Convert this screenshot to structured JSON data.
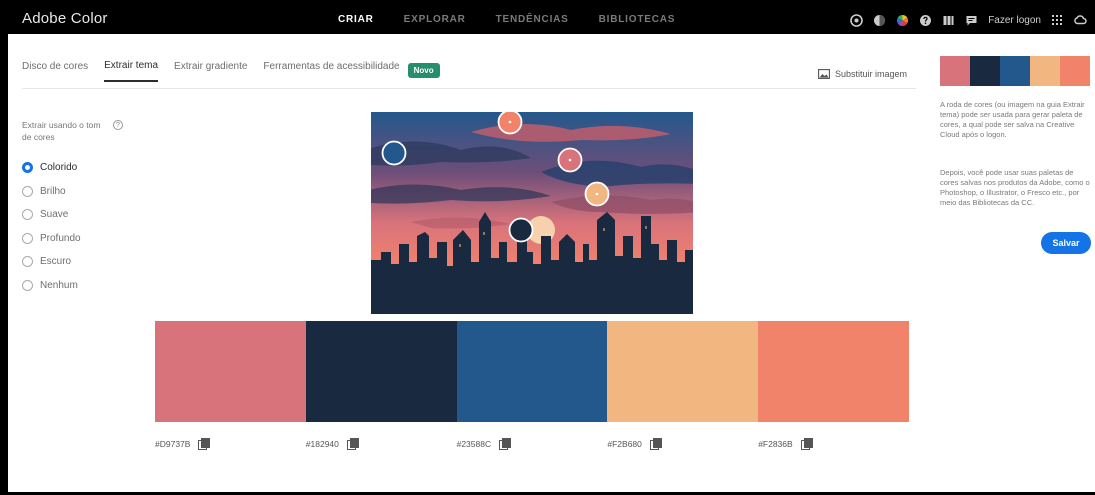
{
  "app": {
    "title": "Adobe Color"
  },
  "nav": [
    {
      "label": "CRIAR",
      "active": true
    },
    {
      "label": "EXPLORAR",
      "active": false
    },
    {
      "label": "TENDÊNCIAS",
      "active": false
    },
    {
      "label": "BIBLIOTECAS",
      "active": false
    }
  ],
  "header": {
    "login_label": "Fazer logon",
    "icons": [
      "accessibility-icon",
      "drop-icon",
      "color-wheel-icon",
      "help-icon",
      "library-icon",
      "chat-icon",
      "app-grid-icon",
      "creative-cloud-icon"
    ]
  },
  "tabs": [
    {
      "label": "Disco de cores",
      "active": false
    },
    {
      "label": "Extrair tema",
      "active": true
    },
    {
      "label": "Extrair gradiente",
      "active": false
    },
    {
      "label": "Ferramentas de acessibilidade",
      "active": false
    }
  ],
  "new_badge": "Novo",
  "replace_image_label": "Substituir imagem",
  "extract": {
    "label": "Extrair usando o tom de cores",
    "help_glyph": "?",
    "options": [
      {
        "label": "Colorido",
        "selected": true
      },
      {
        "label": "Brilho",
        "selected": false
      },
      {
        "label": "Suave",
        "selected": false
      },
      {
        "label": "Profundo",
        "selected": false
      },
      {
        "label": "Escuro",
        "selected": false
      },
      {
        "label": "Nenhum",
        "selected": false
      }
    ]
  },
  "swatches": [
    {
      "hex": "#D9737B",
      "label": "#D9737B"
    },
    {
      "hex": "#182940",
      "label": "#182940"
    },
    {
      "hex": "#23588C",
      "label": "#23588C"
    },
    {
      "hex": "#F2B680",
      "label": "#F2B680"
    },
    {
      "hex": "#F2836B",
      "label": "#F2836B"
    }
  ],
  "side": {
    "info1": "A roda de cores (ou imagem na guia Extrair tema) pode ser usada para gerar paleta de cores, a qual pode ser salva na Creative Cloud após o logon.",
    "info2": "Depois, você pode usar suas paletas de cores salvas nos produtos da Adobe, como o Photoshop, o Illustrator, o Fresco etc., por meio das Bibliotecas da CC.",
    "save_label": "Salvar"
  },
  "colors": {
    "accent": "#1473e6",
    "badge": "#268e6c"
  }
}
